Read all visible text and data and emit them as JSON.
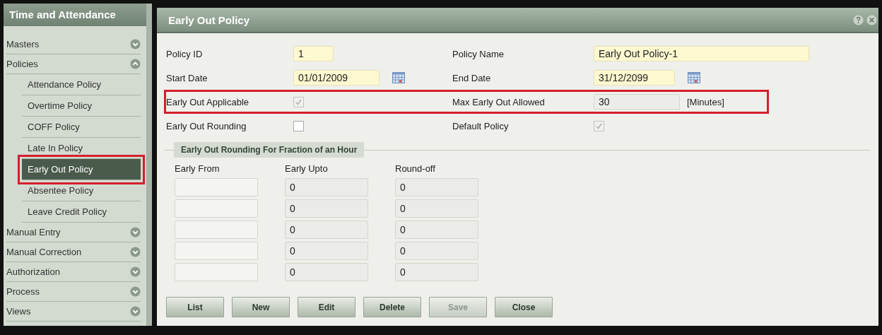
{
  "sidebar": {
    "title": "Time and Attendance",
    "items": [
      {
        "label": "Masters",
        "expanded": false
      },
      {
        "label": "Policies",
        "expanded": true,
        "children": [
          {
            "label": "Attendance Policy",
            "selected": false,
            "highlighted": false
          },
          {
            "label": "Overtime Policy",
            "selected": false,
            "highlighted": false
          },
          {
            "label": "COFF Policy",
            "selected": false,
            "highlighted": false
          },
          {
            "label": "Late In Policy",
            "selected": false,
            "highlighted": false
          },
          {
            "label": "Early Out Policy",
            "selected": true,
            "highlighted": true
          },
          {
            "label": "Absentee Policy",
            "selected": false,
            "highlighted": false
          },
          {
            "label": "Leave Credit Policy",
            "selected": false,
            "highlighted": false
          }
        ]
      },
      {
        "label": "Manual Entry",
        "expanded": false
      },
      {
        "label": "Manual Correction",
        "expanded": false
      },
      {
        "label": "Authorization",
        "expanded": false
      },
      {
        "label": "Process",
        "expanded": false
      },
      {
        "label": "Views",
        "expanded": false
      }
    ]
  },
  "form": {
    "title": "Early Out Policy",
    "rows": [
      {
        "highlighted": false,
        "cells": [
          {
            "label": "Policy ID",
            "kind": "text",
            "value": "1",
            "required": true
          },
          {
            "label": "Policy Name",
            "kind": "text",
            "value": "Early Out Policy-1",
            "required": true
          }
        ]
      },
      {
        "highlighted": false,
        "cells": [
          {
            "label": "Start Date",
            "kind": "date",
            "value": "01/01/2009",
            "required": true
          },
          {
            "label": "End Date",
            "kind": "date",
            "value": "31/12/2099",
            "required": true
          }
        ]
      },
      {
        "highlighted": true,
        "cells": [
          {
            "label": "Early Out Applicable",
            "kind": "checkbox",
            "checked": true,
            "disabled": true
          },
          {
            "label": "Max Early Out Allowed",
            "kind": "unit",
            "value": "30",
            "unit": "[Minutes]",
            "required": false
          }
        ]
      },
      {
        "highlighted": false,
        "cells": [
          {
            "label": "Early Out Rounding",
            "kind": "checkbox",
            "checked": false,
            "disabled": false
          },
          {
            "label": "Default Policy",
            "kind": "checkbox",
            "checked": true,
            "disabled": true
          }
        ]
      }
    ],
    "rounding": {
      "title": "Early Out Rounding For Fraction of an Hour",
      "columns": [
        "Early From",
        "Early Upto",
        "Round-off"
      ],
      "rows": [
        {
          "early_upto": "0",
          "round_off": "0"
        },
        {
          "early_upto": "0",
          "round_off": "0"
        },
        {
          "early_upto": "0",
          "round_off": "0"
        },
        {
          "early_upto": "0",
          "round_off": "0"
        },
        {
          "early_upto": "0",
          "round_off": "0"
        }
      ]
    },
    "buttons": [
      {
        "label": "List",
        "disabled": false
      },
      {
        "label": "New",
        "disabled": false
      },
      {
        "label": "Edit",
        "disabled": false
      },
      {
        "label": "Delete",
        "disabled": false
      },
      {
        "label": "Save",
        "disabled": true
      },
      {
        "label": "Close",
        "disabled": false
      }
    ]
  }
}
